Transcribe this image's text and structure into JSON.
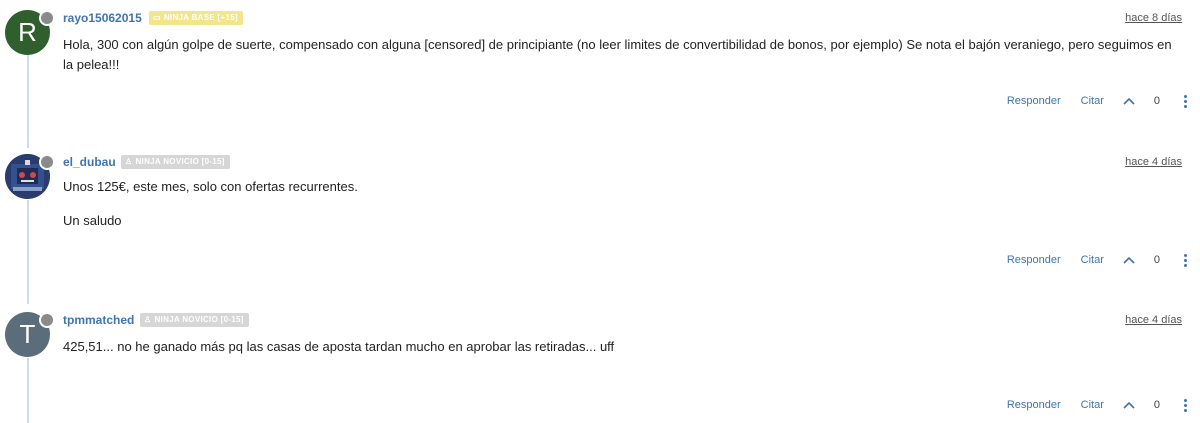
{
  "posts": [
    {
      "avatar_letter": "R",
      "avatar_color": "#2e5f2c",
      "author": "rayo15062015",
      "badge": "NINJA BASE [+15]",
      "badge_icon": "ticket-icon",
      "time": "hace 8 días",
      "paragraphs": [
        "Hola, 300 con algún golpe de suerte, compensado con alguna [censored] de principiante (no leer limites de convertibilidad de bonos, por ejemplo) Se nota el bajón veraniego, pero seguimos en la pelea!!!"
      ],
      "reply_label": "Responder",
      "quote_label": "Citar",
      "votes": "0"
    },
    {
      "avatar_letter": "",
      "avatar_color": "#2a3b6e",
      "author": "el_dubau",
      "badge": "NINJA NOVICIO [0-15]",
      "badge_icon": "figure-icon",
      "time": "hace 4 días",
      "paragraphs": [
        "Unos 125€, este mes, solo con ofertas recurrentes.",
        "Un saludo"
      ],
      "reply_label": "Responder",
      "quote_label": "Citar",
      "votes": "0"
    },
    {
      "avatar_letter": "T",
      "avatar_color": "#5b6d7a",
      "author": "tpmmatched",
      "badge": "NINJA NOVICIO [0-15]",
      "badge_icon": "figure-icon",
      "time": "hace 4 días",
      "paragraphs": [
        "425,51... no he ganado más pq las casas de aposta tardan mucho en aprobar las retiradas... uff"
      ],
      "reply_label": "Responder",
      "quote_label": "Citar",
      "votes": "0"
    }
  ],
  "colors": {
    "link": "#3f74b1",
    "thread_line": "#c9ddef",
    "badge_base": "#f3e58c",
    "badge_novice": "#d6d6d6"
  }
}
